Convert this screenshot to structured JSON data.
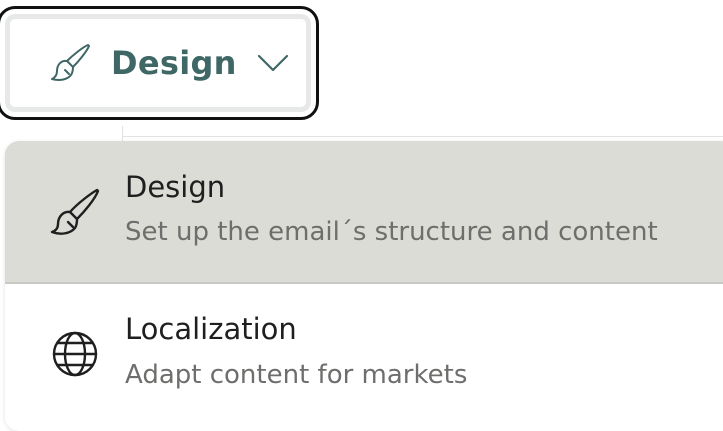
{
  "trigger": {
    "label": "Design",
    "icon": "paintbrush-icon",
    "chevron_icon": "chevron-down-icon",
    "label_color": "#3f6766"
  },
  "menu": {
    "items": [
      {
        "title": "Design",
        "description": "Set up the email´s structure and content",
        "icon": "paintbrush-icon",
        "selected": true
      },
      {
        "title": "Localization",
        "description": "Adapt content for markets",
        "icon": "globe-icon",
        "selected": false
      }
    ]
  },
  "colors": {
    "selected_background": "#dcdcd7",
    "focus_ring": "#111111",
    "description_text": "#6d6f6c"
  }
}
